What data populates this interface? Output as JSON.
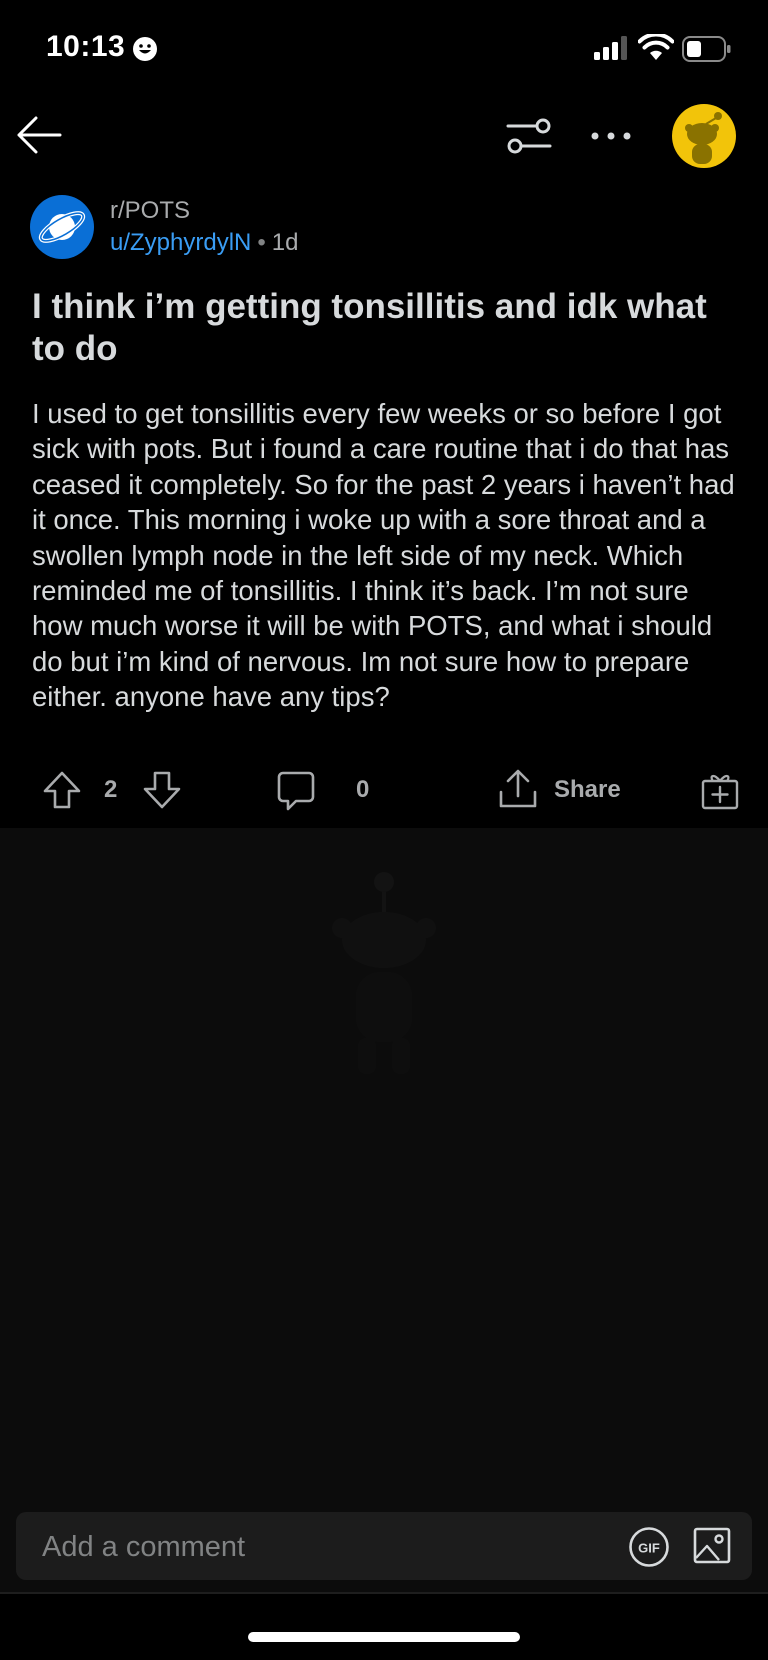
{
  "status_bar": {
    "time": "10:13"
  },
  "post": {
    "subreddit": "r/POTS",
    "author": "u/ZyphyrdylN",
    "age": "1d",
    "separator": "•",
    "title": "I think i’m getting tonsillitis and idk what to do",
    "body": "I used to get tonsillitis every few weeks or so before I got sick with pots. But i found a care routine that i do that has ceased it completely. So for the past 2 years i haven’t had it once. This morning i woke up with a sore throat and a swollen lymph node in the left side of my neck. Which reminded me of tonsillitis. I think it’s back. I’m not sure how much worse it will be with POTS, and what i should do but i’m kind of nervous. Im not sure how to prepare either. anyone have any tips?"
  },
  "actions": {
    "votes": "2",
    "comments": "0",
    "share_label": "Share"
  },
  "comment_bar": {
    "placeholder": "Add a comment",
    "gif_label": "GIF"
  },
  "colors": {
    "background": "#000000",
    "accent_blue": "#3a9df4",
    "subreddit_icon": "#0a6fd6",
    "avatar_yellow": "#f2c40a"
  },
  "icons": [
    "back-arrow-icon",
    "filter-icon",
    "more-icon",
    "snoo-avatar-icon",
    "planet-icon",
    "upvote-icon",
    "downvote-icon",
    "comment-icon",
    "share-icon",
    "award-icon",
    "gif-icon",
    "image-icon"
  ]
}
